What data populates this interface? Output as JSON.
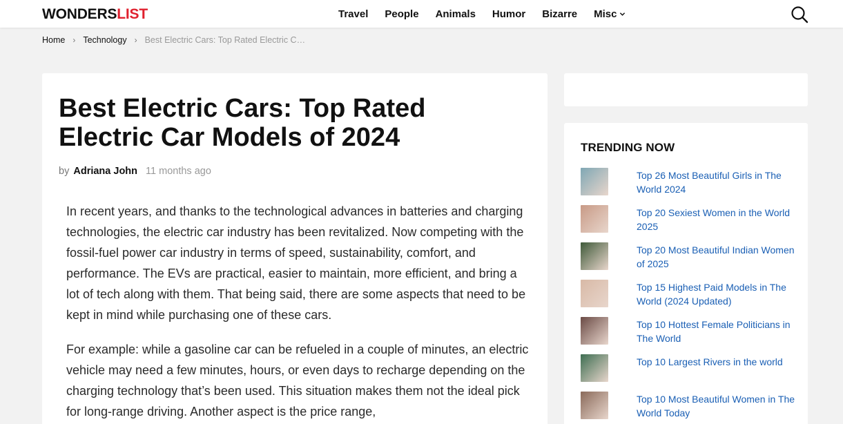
{
  "header": {
    "logo_main": "WONDERS",
    "logo_accent": "LIST",
    "nav": [
      "Travel",
      "People",
      "Animals",
      "Humor",
      "Bizarre",
      "Misc"
    ],
    "search_icon": "search-icon"
  },
  "breadcrumb": {
    "home": "Home",
    "category": "Technology",
    "current": "Best Electric Cars: Top Rated Electric C…",
    "separator": "›"
  },
  "article": {
    "title": "Best Electric Cars: Top Rated Electric Car Models of 2024",
    "by": "by",
    "author": "Adriana John",
    "date": "11 months ago",
    "paragraphs": [
      "In recent years, and thanks to the technological advances in batteries and charging technologies, the electric car industry has been revitalized. Now competing with the fossil-fuel power car industry in terms of speed, sustainability, comfort, and performance. The EVs are practical, easier to maintain, more efficient, and bring a lot of tech along with them. That being said, there are some aspects that need to be kept in mind while purchasing one of these cars.",
      "For example: while a gasoline car can be refueled in a couple of minutes, an electric vehicle may need a few minutes, hours, or even days to recharge depending on the charging technology that’s been used. This situation makes them not the ideal pick for long-range driving. Another aspect is the price range,"
    ]
  },
  "trending": {
    "heading": "TRENDING NOW",
    "items": [
      {
        "title": "Top 26 Most Beautiful Girls in The World 2024",
        "thumb": "#7fa7b4"
      },
      {
        "title": "Top 20 Sexiest Women in the World 2025",
        "thumb": "#c89a86"
      },
      {
        "title": "Top 20 Most Beautiful Indian Women of 2025",
        "thumb": "#3f5a3a"
      },
      {
        "title": "Top 15 Highest Paid Models in The World (2024 Updated)",
        "thumb": "#d8b9a6"
      },
      {
        "title": "Top 10 Hottest Female Politicians in The World",
        "thumb": "#6b4b46"
      },
      {
        "title": "Top 10 Largest Rivers in the world",
        "thumb": "#3e6e52"
      },
      {
        "title": "Top 10 Most Beautiful Women in The World Today",
        "thumb": "#8a6a5a"
      }
    ]
  },
  "colors": {
    "accent": "#e0202e",
    "link": "#1a5fb4"
  }
}
